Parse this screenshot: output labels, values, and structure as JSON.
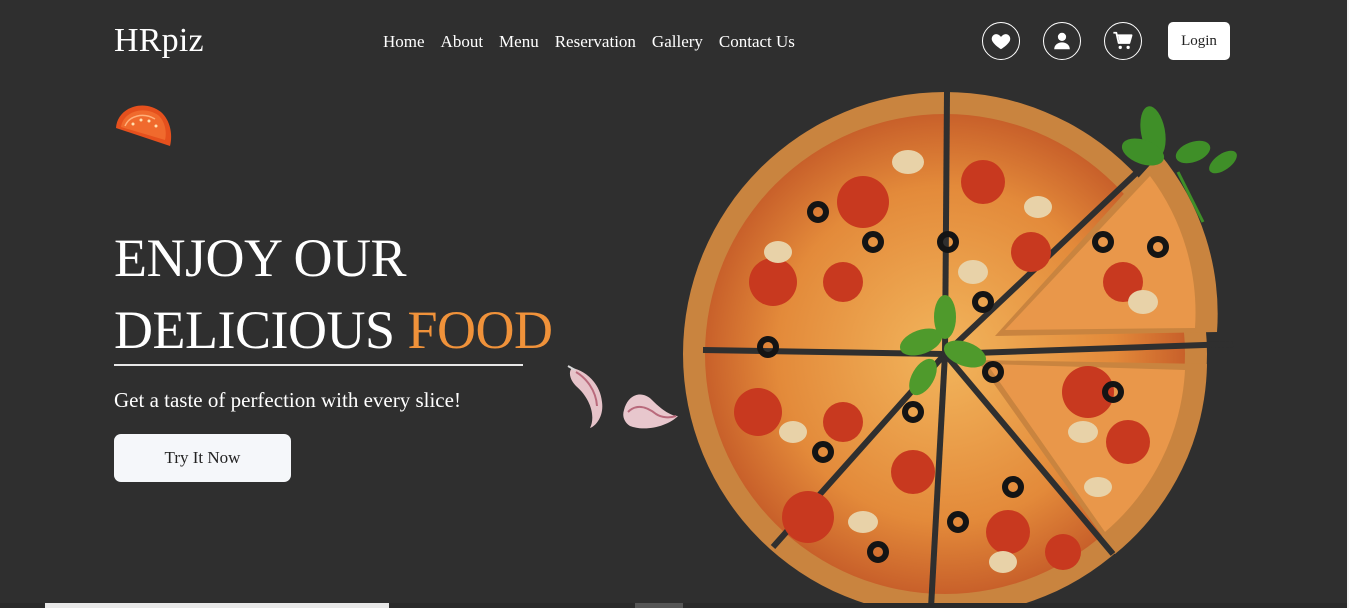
{
  "brand": {
    "name": "HRpiz"
  },
  "nav": {
    "items": [
      {
        "label": "Home"
      },
      {
        "label": "About"
      },
      {
        "label": "Menu"
      },
      {
        "label": "Reservation"
      },
      {
        "label": "Gallery"
      },
      {
        "label": "Contact Us"
      }
    ]
  },
  "actions": {
    "icons": [
      "heart-icon",
      "user-icon",
      "cart-icon"
    ],
    "login_label": "Login"
  },
  "hero": {
    "line1": "ENJOY OUR",
    "line2_main": "DELICIOUS",
    "line2_accent": "FOOD",
    "tagline": "Get a taste of perfection with every slice!",
    "cta_label": "Try It Now"
  },
  "colors": {
    "background": "#2f2f2f",
    "accent": "#f0923a",
    "button_bg": "#f5f7fa"
  }
}
